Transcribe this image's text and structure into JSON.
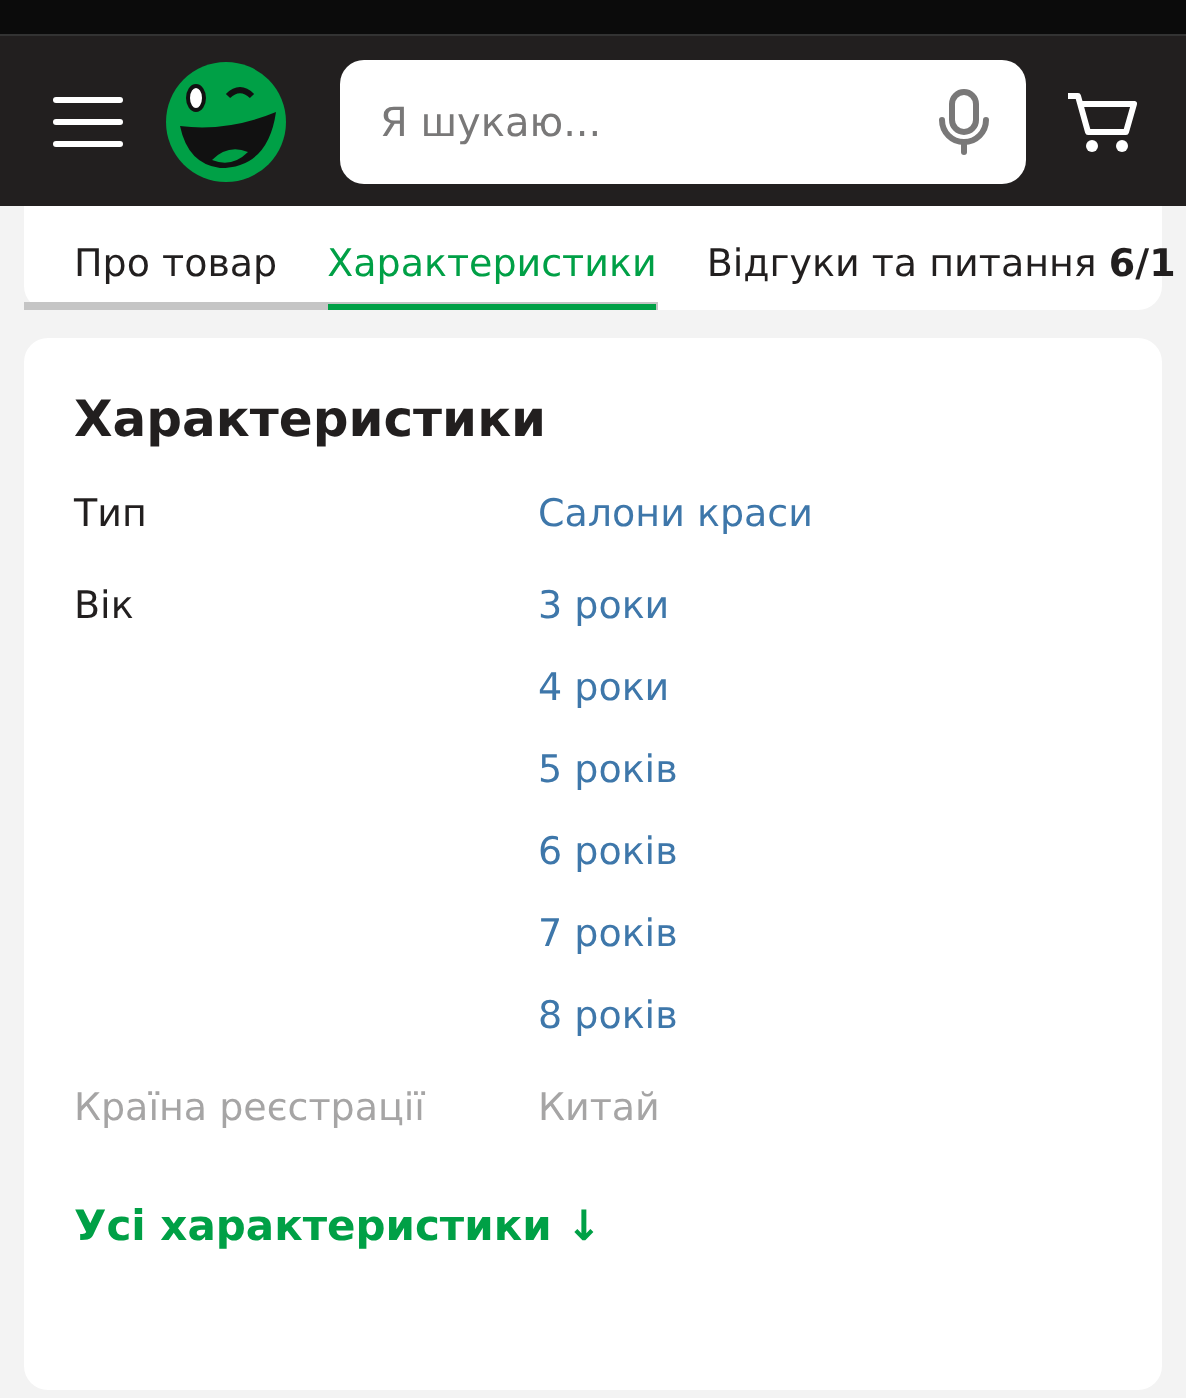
{
  "search": {
    "placeholder": "Я шукаю..."
  },
  "tabs": [
    {
      "label": "Про товар",
      "selected": false
    },
    {
      "label": "Характеристики",
      "selected": true
    },
    {
      "label": "Відгуки та питання **6/1**",
      "selected": false
    }
  ],
  "section": {
    "title": "Характеристики",
    "rows": [
      {
        "label": "Тип",
        "values": [
          "Салони краси"
        ],
        "faded": false
      },
      {
        "label": "Вік",
        "values": [
          "3 роки",
          "4 роки",
          "5 років",
          "6 років",
          "7 років",
          "8 років"
        ],
        "faded": false
      },
      {
        "label": "Країна реєстрації",
        "values": [
          "Китай"
        ],
        "faded": true
      }
    ],
    "more_link": "Усі характеристики ↓"
  }
}
